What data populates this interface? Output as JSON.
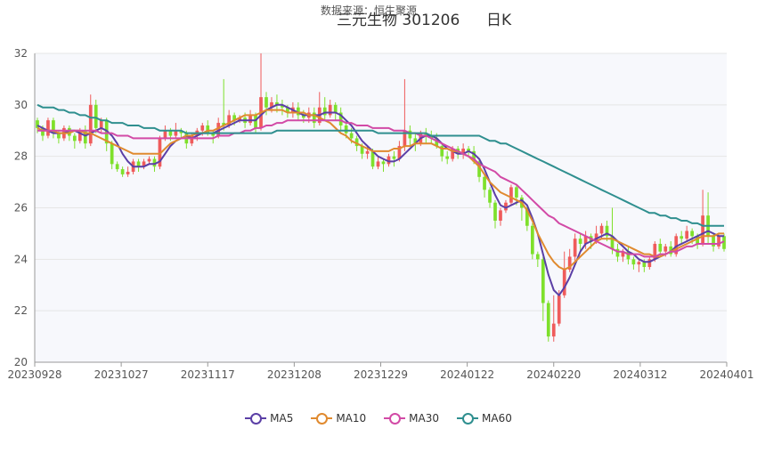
{
  "title": "三元生物 301206",
  "period": "日K",
  "subtitle": "数据来源：恒生聚源",
  "colors": {
    "up": "#ef5b5b",
    "down": "#7ee02b",
    "MA5": "#5b3fa6",
    "MA10": "#e08a2f",
    "MA30": "#d24aa6",
    "MA60": "#2f8f8f",
    "grid": "#e6e6e6",
    "plot_bg": "#f7f8fc"
  },
  "chart_data": {
    "type": "candlestick",
    "x_tick_labels": [
      "20230928",
      "20231027",
      "20231117",
      "20231208",
      "20231229",
      "20240122",
      "20240220",
      "20240312",
      "20240401"
    ],
    "y_tick_labels": [
      "20",
      "22",
      "24",
      "26",
      "28",
      "30",
      "32"
    ],
    "ylim": [
      20,
      32
    ],
    "grid": true,
    "legend_position": "bottom",
    "legend": [
      "MA5",
      "MA10",
      "MA30",
      "MA60"
    ],
    "candles": [
      [
        29.4,
        29.1,
        29.5,
        28.9
      ],
      [
        29.1,
        28.8,
        29.2,
        28.6
      ],
      [
        28.8,
        29.4,
        29.5,
        28.7
      ],
      [
        29.4,
        28.9,
        29.5,
        28.7
      ],
      [
        28.9,
        28.7,
        29.0,
        28.5
      ],
      [
        28.7,
        29.1,
        29.2,
        28.6
      ],
      [
        29.1,
        28.8,
        29.2,
        28.6
      ],
      [
        28.8,
        28.6,
        28.9,
        28.3
      ],
      [
        28.6,
        29.0,
        29.1,
        28.5
      ],
      [
        29.0,
        28.5,
        29.2,
        28.3
      ],
      [
        28.5,
        30.0,
        30.4,
        28.4
      ],
      [
        30.0,
        29.1,
        30.2,
        28.9
      ],
      [
        29.1,
        29.4,
        29.5,
        28.9
      ],
      [
        29.4,
        28.5,
        29.5,
        28.2
      ],
      [
        28.5,
        27.7,
        28.6,
        27.5
      ],
      [
        27.7,
        27.5,
        27.8,
        27.4
      ],
      [
        27.5,
        27.3,
        27.6,
        27.2
      ],
      [
        27.3,
        27.4,
        27.6,
        27.2
      ],
      [
        27.4,
        27.8,
        27.9,
        27.3
      ],
      [
        27.8,
        27.6,
        27.9,
        27.4
      ],
      [
        27.6,
        27.8,
        27.9,
        27.5
      ],
      [
        27.8,
        27.9,
        28.0,
        27.7
      ],
      [
        27.9,
        27.6,
        28.0,
        27.4
      ],
      [
        27.6,
        28.7,
        28.8,
        27.5
      ],
      [
        28.7,
        29.0,
        29.2,
        28.6
      ],
      [
        29.0,
        28.8,
        29.1,
        28.6
      ],
      [
        28.8,
        29.0,
        29.3,
        28.7
      ],
      [
        29.0,
        28.9,
        29.1,
        28.7
      ],
      [
        28.9,
        28.5,
        29.0,
        28.3
      ],
      [
        28.5,
        28.8,
        28.9,
        28.4
      ],
      [
        28.8,
        29.0,
        29.1,
        28.6
      ],
      [
        29.0,
        29.2,
        29.3,
        28.8
      ],
      [
        29.2,
        28.9,
        29.4,
        28.8
      ],
      [
        28.9,
        28.8,
        29.0,
        28.5
      ],
      [
        28.8,
        29.3,
        29.5,
        28.7
      ],
      [
        29.3,
        29.2,
        31.0,
        29.0
      ],
      [
        29.2,
        29.6,
        29.8,
        29.1
      ],
      [
        29.6,
        29.4,
        29.7,
        29.2
      ],
      [
        29.4,
        29.5,
        29.6,
        29.3
      ],
      [
        29.5,
        29.3,
        29.7,
        29.1
      ],
      [
        29.3,
        29.6,
        29.8,
        29.2
      ],
      [
        29.6,
        29.1,
        29.7,
        28.9
      ],
      [
        29.1,
        30.3,
        32.0,
        29.0
      ],
      [
        30.3,
        29.9,
        30.5,
        29.6
      ],
      [
        29.9,
        30.1,
        30.3,
        29.7
      ],
      [
        30.1,
        30.0,
        30.4,
        29.7
      ],
      [
        30.0,
        29.9,
        30.2,
        29.6
      ],
      [
        29.9,
        29.7,
        30.0,
        29.5
      ],
      [
        29.7,
        29.9,
        30.1,
        29.5
      ],
      [
        29.9,
        29.6,
        30.1,
        29.4
      ],
      [
        29.6,
        29.5,
        29.8,
        29.3
      ],
      [
        29.5,
        29.7,
        29.9,
        29.3
      ],
      [
        29.7,
        29.3,
        29.9,
        29.1
      ],
      [
        29.3,
        29.9,
        30.5,
        29.2
      ],
      [
        29.9,
        29.6,
        30.3,
        29.4
      ],
      [
        29.6,
        30.0,
        30.2,
        29.5
      ],
      [
        30.0,
        29.7,
        30.1,
        29.4
      ],
      [
        29.7,
        29.2,
        29.9,
        29.0
      ],
      [
        29.2,
        28.9,
        29.4,
        28.7
      ],
      [
        28.9,
        28.7,
        29.1,
        28.5
      ],
      [
        28.7,
        28.4,
        28.8,
        28.2
      ],
      [
        28.4,
        28.1,
        28.5,
        27.9
      ],
      [
        28.1,
        28.2,
        28.4,
        27.9
      ],
      [
        28.2,
        27.6,
        28.3,
        27.5
      ],
      [
        27.6,
        27.8,
        28.0,
        27.5
      ],
      [
        27.8,
        27.7,
        27.9,
        27.4
      ],
      [
        27.7,
        28.0,
        28.1,
        27.6
      ],
      [
        28.0,
        27.9,
        28.2,
        27.6
      ],
      [
        27.9,
        28.4,
        28.6,
        27.8
      ],
      [
        28.4,
        29.0,
        31.0,
        28.2
      ],
      [
        29.0,
        28.7,
        29.2,
        28.4
      ],
      [
        28.7,
        28.5,
        28.9,
        28.2
      ],
      [
        28.5,
        28.9,
        29.0,
        28.4
      ],
      [
        28.9,
        28.8,
        29.1,
        28.5
      ],
      [
        28.8,
        28.7,
        29.0,
        28.5
      ],
      [
        28.7,
        28.4,
        28.9,
        28.3
      ],
      [
        28.4,
        28.0,
        28.5,
        27.8
      ],
      [
        28.0,
        27.9,
        28.2,
        27.7
      ],
      [
        27.9,
        28.3,
        28.4,
        27.8
      ],
      [
        28.3,
        28.1,
        28.4,
        27.9
      ],
      [
        28.1,
        28.3,
        28.5,
        27.9
      ],
      [
        28.3,
        28.2,
        28.4,
        28.0
      ],
      [
        28.2,
        27.8,
        28.4,
        27.7
      ],
      [
        27.8,
        27.2,
        27.9,
        27.0
      ],
      [
        27.2,
        26.7,
        27.3,
        26.4
      ],
      [
        26.7,
        26.2,
        26.8,
        26.0
      ],
      [
        26.2,
        25.5,
        26.3,
        25.2
      ],
      [
        25.5,
        25.9,
        26.0,
        25.3
      ],
      [
        25.9,
        26.2,
        26.3,
        25.8
      ],
      [
        26.2,
        26.8,
        26.9,
        26.1
      ],
      [
        26.8,
        26.4,
        26.9,
        26.1
      ],
      [
        26.4,
        26.0,
        26.5,
        25.5
      ],
      [
        26.0,
        25.3,
        26.1,
        25.1
      ],
      [
        25.3,
        24.2,
        25.4,
        24.0
      ],
      [
        24.2,
        24.0,
        24.3,
        23.7
      ],
      [
        24.0,
        22.3,
        24.1,
        21.6
      ],
      [
        22.3,
        21.0,
        22.4,
        20.8
      ],
      [
        21.0,
        21.5,
        22.6,
        20.8
      ],
      [
        21.5,
        22.6,
        22.8,
        21.4
      ],
      [
        22.6,
        23.6,
        24.3,
        22.5
      ],
      [
        23.6,
        24.1,
        24.4,
        23.5
      ],
      [
        24.1,
        24.8,
        25.0,
        23.9
      ],
      [
        24.8,
        24.6,
        25.0,
        24.3
      ],
      [
        24.6,
        24.9,
        25.1,
        24.4
      ],
      [
        24.9,
        24.7,
        25.0,
        24.4
      ],
      [
        24.7,
        25.0,
        25.3,
        24.6
      ],
      [
        25.0,
        25.3,
        25.4,
        24.8
      ],
      [
        25.3,
        24.9,
        25.5,
        24.7
      ],
      [
        24.9,
        24.4,
        26.0,
        24.2
      ],
      [
        24.4,
        24.1,
        24.6,
        23.9
      ],
      [
        24.1,
        24.3,
        24.4,
        23.9
      ],
      [
        24.3,
        24.0,
        24.5,
        23.8
      ],
      [
        24.0,
        23.8,
        24.1,
        23.6
      ],
      [
        23.8,
        23.9,
        24.0,
        23.5
      ],
      [
        23.9,
        23.7,
        24.0,
        23.5
      ],
      [
        23.7,
        24.0,
        24.1,
        23.6
      ],
      [
        24.0,
        24.6,
        24.7,
        23.9
      ],
      [
        24.6,
        24.3,
        24.8,
        24.1
      ],
      [
        24.3,
        24.5,
        24.6,
        24.1
      ],
      [
        24.5,
        24.2,
        24.7,
        24.1
      ],
      [
        24.2,
        24.9,
        25.0,
        24.1
      ],
      [
        24.9,
        24.8,
        25.1,
        24.6
      ],
      [
        24.8,
        25.1,
        25.3,
        24.7
      ],
      [
        25.1,
        24.9,
        25.2,
        24.6
      ],
      [
        24.9,
        24.6,
        25.0,
        24.4
      ],
      [
        24.6,
        25.7,
        26.7,
        24.5
      ],
      [
        25.7,
        24.9,
        26.6,
        24.6
      ],
      [
        24.9,
        24.5,
        25.0,
        24.3
      ],
      [
        24.5,
        24.9,
        25.0,
        24.4
      ],
      [
        24.9,
        24.4,
        25.0,
        24.3
      ]
    ],
    "series": [
      {
        "name": "MA5",
        "values": [
          29.2,
          29.1,
          29.0,
          28.9,
          28.9,
          28.9,
          29.0,
          29.0,
          28.9,
          28.8,
          28.9,
          29.0,
          29.1,
          29.0,
          28.8,
          28.5,
          28.1,
          27.8,
          27.6,
          27.6,
          27.6,
          27.7,
          27.7,
          27.8,
          28.1,
          28.4,
          28.6,
          28.7,
          28.8,
          28.7,
          28.8,
          28.9,
          28.9,
          28.9,
          29.0,
          29.1,
          29.2,
          29.3,
          29.4,
          29.4,
          29.4,
          29.4,
          29.6,
          29.8,
          29.9,
          30.0,
          30.0,
          29.9,
          29.8,
          29.7,
          29.6,
          29.6,
          29.6,
          29.6,
          29.7,
          29.7,
          29.7,
          29.6,
          29.4,
          29.2,
          28.9,
          28.6,
          28.4,
          28.2,
          28.0,
          27.9,
          27.8,
          27.8,
          27.9,
          28.1,
          28.3,
          28.5,
          28.7,
          28.8,
          28.8,
          28.7,
          28.5,
          28.3,
          28.2,
          28.1,
          28.1,
          28.2,
          28.1,
          27.9,
          27.5,
          27.0,
          26.5,
          26.1,
          26.0,
          26.1,
          26.2,
          26.3,
          26.1,
          25.6,
          25.0,
          24.2,
          23.4,
          22.8,
          22.6,
          22.9,
          23.3,
          23.8,
          24.3,
          24.6,
          24.7,
          24.8,
          24.9,
          25.0,
          24.9,
          24.7,
          24.5,
          24.3,
          24.2,
          24.0,
          23.9,
          23.9,
          24.0,
          24.1,
          24.2,
          24.3,
          24.5,
          24.6,
          24.7,
          24.8,
          24.9,
          25.0,
          25.1,
          25.0,
          24.9,
          24.9
        ]
      },
      {
        "name": "MA10",
        "values": [
          29.1,
          29.0,
          29.0,
          29.0,
          28.9,
          28.9,
          28.9,
          29.0,
          29.0,
          28.9,
          28.9,
          28.8,
          28.7,
          28.6,
          28.5,
          28.4,
          28.3,
          28.2,
          28.1,
          28.1,
          28.1,
          28.1,
          28.1,
          28.1,
          28.3,
          28.5,
          28.6,
          28.7,
          28.8,
          28.8,
          28.9,
          28.9,
          29.0,
          29.0,
          29.1,
          29.2,
          29.3,
          29.4,
          29.5,
          29.6,
          29.6,
          29.6,
          29.7,
          29.8,
          29.8,
          29.8,
          29.8,
          29.7,
          29.7,
          29.7,
          29.7,
          29.6,
          29.6,
          29.5,
          29.4,
          29.3,
          29.1,
          28.9,
          28.8,
          28.6,
          28.5,
          28.4,
          28.3,
          28.2,
          28.2,
          28.2,
          28.2,
          28.3,
          28.3,
          28.4,
          28.4,
          28.5,
          28.5,
          28.5,
          28.5,
          28.4,
          28.3,
          28.3,
          28.2,
          28.2,
          28.1,
          28.0,
          27.8,
          27.6,
          27.3,
          27.0,
          26.8,
          26.6,
          26.5,
          26.4,
          26.3,
          26.2,
          25.9,
          25.5,
          25.0,
          24.6,
          24.2,
          23.9,
          23.7,
          23.6,
          23.7,
          23.9,
          24.1,
          24.3,
          24.5,
          24.7,
          24.8,
          24.8,
          24.8,
          24.7,
          24.6,
          24.5,
          24.4,
          24.3,
          24.2,
          24.2,
          24.1,
          24.1,
          24.2,
          24.3,
          24.4,
          24.5,
          24.6,
          24.7,
          24.8,
          24.9,
          24.9,
          24.9,
          25.0,
          25.0
        ]
      },
      {
        "name": "MA30",
        "values": [
          29.0,
          29.0,
          29.0,
          29.0,
          29.0,
          29.0,
          29.0,
          29.0,
          29.0,
          29.0,
          29.0,
          29.0,
          28.9,
          28.9,
          28.9,
          28.8,
          28.8,
          28.8,
          28.7,
          28.7,
          28.7,
          28.7,
          28.7,
          28.7,
          28.7,
          28.7,
          28.7,
          28.7,
          28.7,
          28.7,
          28.7,
          28.7,
          28.7,
          28.7,
          28.8,
          28.8,
          28.8,
          28.9,
          28.9,
          29.0,
          29.0,
          29.1,
          29.1,
          29.2,
          29.2,
          29.3,
          29.3,
          29.4,
          29.4,
          29.4,
          29.4,
          29.4,
          29.4,
          29.4,
          29.4,
          29.4,
          29.4,
          29.4,
          29.3,
          29.3,
          29.2,
          29.2,
          29.2,
          29.1,
          29.1,
          29.1,
          29.1,
          29.0,
          29.0,
          29.0,
          28.9,
          28.9,
          28.8,
          28.8,
          28.7,
          28.6,
          28.5,
          28.4,
          28.3,
          28.2,
          28.1,
          28.0,
          27.9,
          27.7,
          27.6,
          27.5,
          27.4,
          27.2,
          27.1,
          27.0,
          26.9,
          26.7,
          26.5,
          26.3,
          26.1,
          25.9,
          25.7,
          25.6,
          25.4,
          25.3,
          25.2,
          25.1,
          25.0,
          24.9,
          24.8,
          24.7,
          24.6,
          24.5,
          24.4,
          24.3,
          24.3,
          24.2,
          24.2,
          24.2,
          24.1,
          24.1,
          24.1,
          24.2,
          24.2,
          24.3,
          24.3,
          24.4,
          24.5,
          24.5,
          24.6,
          24.6,
          24.6,
          24.6,
          24.6,
          24.7
        ]
      },
      {
        "name": "MA60",
        "values": [
          30.0,
          29.9,
          29.9,
          29.9,
          29.8,
          29.8,
          29.7,
          29.7,
          29.6,
          29.6,
          29.5,
          29.5,
          29.4,
          29.4,
          29.3,
          29.3,
          29.3,
          29.2,
          29.2,
          29.2,
          29.1,
          29.1,
          29.1,
          29.0,
          29.0,
          29.0,
          29.0,
          29.0,
          28.9,
          28.9,
          28.9,
          28.9,
          28.9,
          28.9,
          28.9,
          28.9,
          28.9,
          28.9,
          28.9,
          28.9,
          28.9,
          28.9,
          28.9,
          28.9,
          28.9,
          29.0,
          29.0,
          29.0,
          29.0,
          29.0,
          29.0,
          29.0,
          29.0,
          29.0,
          29.0,
          29.0,
          29.0,
          29.0,
          29.0,
          29.0,
          29.0,
          29.0,
          29.0,
          29.0,
          28.9,
          28.9,
          28.9,
          28.9,
          28.9,
          28.9,
          28.9,
          28.9,
          28.9,
          28.9,
          28.8,
          28.8,
          28.8,
          28.8,
          28.8,
          28.8,
          28.8,
          28.8,
          28.8,
          28.8,
          28.7,
          28.6,
          28.6,
          28.5,
          28.5,
          28.4,
          28.3,
          28.2,
          28.1,
          28.0,
          27.9,
          27.8,
          27.7,
          27.6,
          27.5,
          27.4,
          27.3,
          27.2,
          27.1,
          27.0,
          26.9,
          26.8,
          26.7,
          26.6,
          26.5,
          26.4,
          26.3,
          26.2,
          26.1,
          26.0,
          25.9,
          25.8,
          25.8,
          25.7,
          25.7,
          25.6,
          25.6,
          25.5,
          25.5,
          25.4,
          25.4,
          25.3,
          25.3,
          25.3,
          25.3,
          25.3
        ]
      }
    ]
  }
}
